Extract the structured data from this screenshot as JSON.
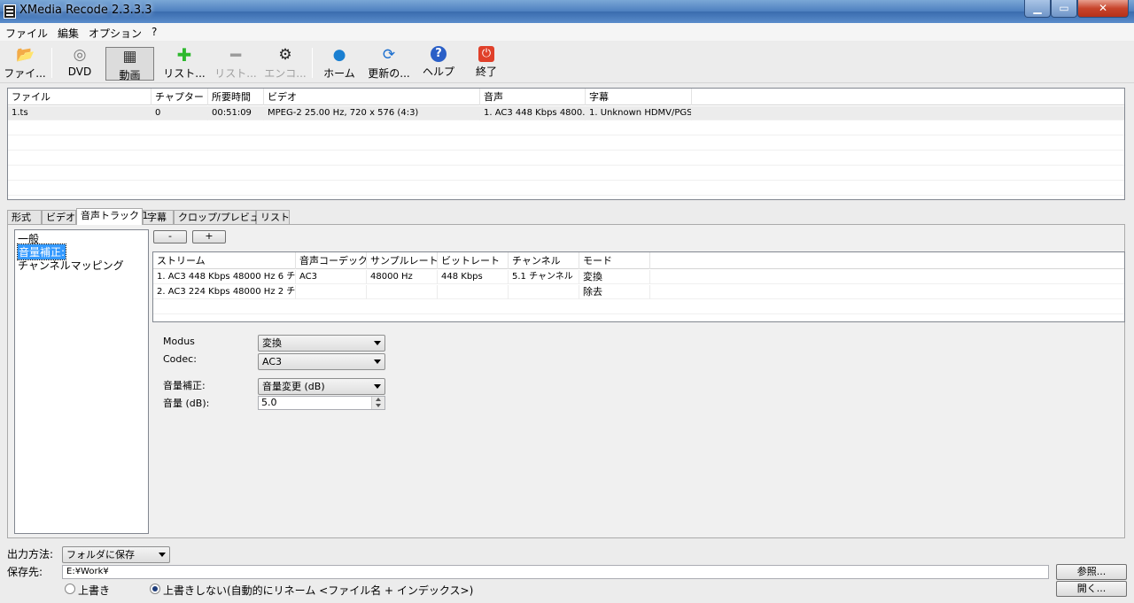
{
  "window": {
    "title": "XMedia Recode 2.3.3.3"
  },
  "menu": [
    "ファイル",
    "編集",
    "オプション",
    "?"
  ],
  "toolbar": {
    "file": "ファイ...",
    "dvd": "DVD",
    "video": "動画",
    "list_add": "リスト...",
    "list_remove": "リスト...",
    "encode": "エンコ...",
    "home": "ホーム",
    "update": "更新の...",
    "help": "ヘルプ",
    "exit": "終了"
  },
  "file_list": {
    "headers": [
      "ファイル",
      "チャプター",
      "所要時間",
      "ビデオ",
      "音声",
      "字幕"
    ],
    "rows": [
      [
        "1.ts",
        "0",
        "00:51:09",
        "MPEG-2 25.00 Hz, 720 x 576 (4:3)",
        "1. AC3 448 Kbps 4800...",
        "1. Unknown HDMV/PGS"
      ]
    ]
  },
  "tabs": [
    "形式",
    "ビデオ",
    "音声トラック 1",
    "字幕",
    "クロップ/プレビュー",
    "リスト"
  ],
  "tree": [
    "一般",
    "音量補正:",
    "チャンネルマッピング"
  ],
  "stream_buttons": {
    "minus": "-",
    "plus": "+"
  },
  "streams": {
    "headers": [
      "ストリーム",
      "音声コーデック",
      "サンプルレート",
      "ビットレート",
      "チャンネル",
      "モード"
    ],
    "rows": [
      [
        "1. AC3 448 Kbps 48000 Hz 6 チ...",
        "AC3",
        "48000 Hz",
        "448 Kbps",
        "5.1 チャンネル",
        "変換"
      ],
      [
        "2. AC3 224 Kbps 48000 Hz 2 チ...",
        "",
        "",
        "",
        "",
        "除去"
      ]
    ]
  },
  "settings": {
    "modus_label": "Modus",
    "modus_value": "変換",
    "codec_label": "Codec:",
    "codec_value": "AC3",
    "volume_corr_label": "音量補正:",
    "volume_corr_value": "音量変更 (dB)",
    "volume_label": "音量 (dB):",
    "volume_value": "5.0"
  },
  "output": {
    "method_label": "出力方法:",
    "method_value": "フォルダに保存",
    "dest_label": "保存先:",
    "dest_value": "E:¥Work¥",
    "browse": "参照...",
    "open": "開く...",
    "overwrite": "上書き",
    "no_overwrite": "上書きしない(自動的にリネーム <ファイル名 + インデックス>)"
  }
}
